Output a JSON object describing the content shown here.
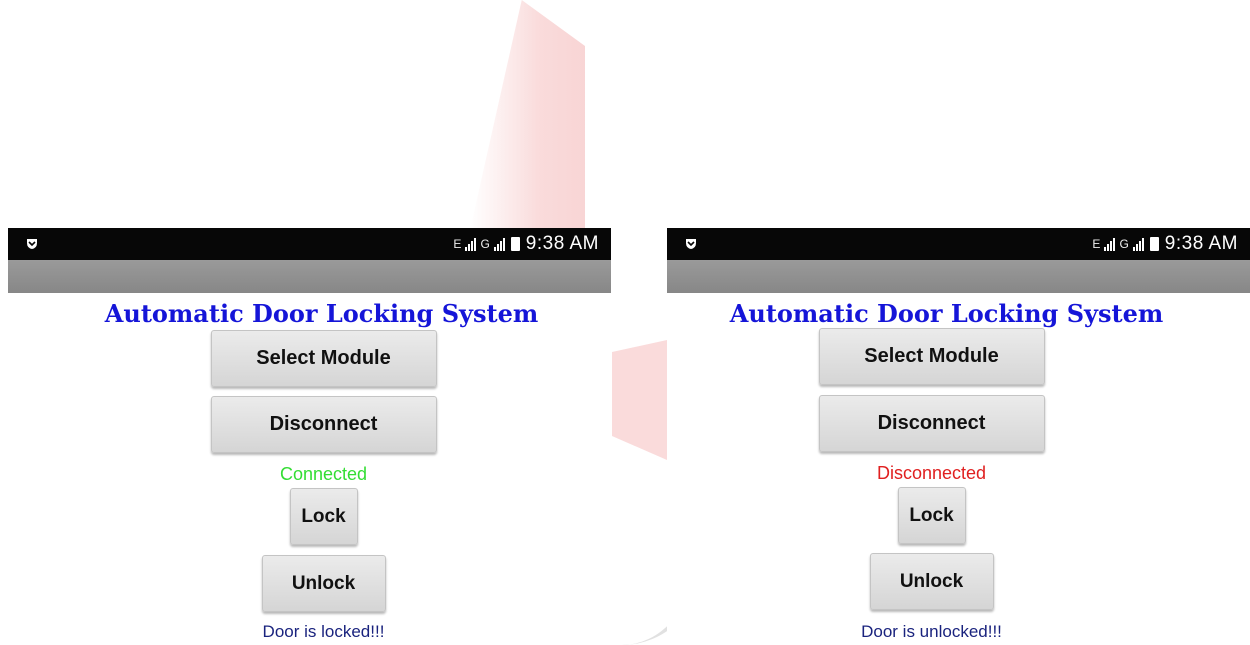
{
  "screens": [
    {
      "status_bar": {
        "time": "9:38 AM",
        "network_e": "E",
        "network_g": "G"
      },
      "title": "Automatic Door Locking System",
      "select_module_label": "Select Module",
      "disconnect_label": "Disconnect",
      "connection_status": "Connected",
      "connection_status_color": "#33dd33",
      "lock_label": "Lock",
      "unlock_label": "Unlock",
      "door_status": "Door is locked!!!"
    },
    {
      "status_bar": {
        "time": "9:38 AM",
        "network_e": "E",
        "network_g": "G"
      },
      "title": "Automatic Door Locking System",
      "select_module_label": "Select Module",
      "disconnect_label": "Disconnect",
      "connection_status": "Disconnected",
      "connection_status_color": "#e02020",
      "lock_label": "Lock",
      "unlock_label": "Unlock",
      "door_status": "Door is unlocked!!!"
    }
  ],
  "colors": {
    "title": "#1515d8",
    "status_bar_bg": "#070707",
    "action_bar_bg": "#8f8f8f",
    "door_status_text": "#1a237e"
  },
  "icons": [
    "notification-shield-icon",
    "signal-bars-icon",
    "battery-icon"
  ]
}
